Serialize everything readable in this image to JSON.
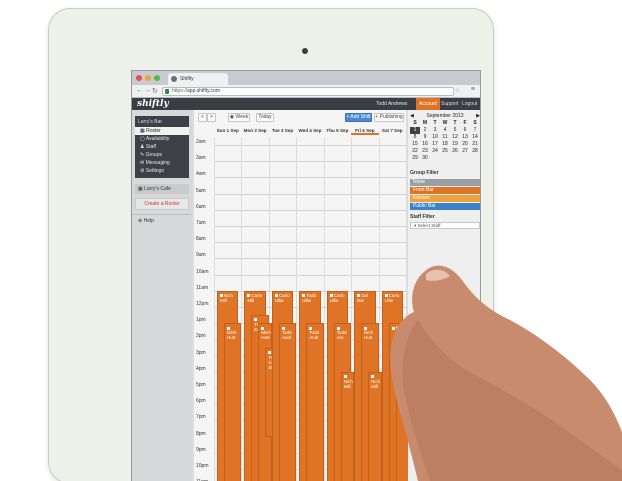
{
  "browser": {
    "tab_title": "Shiftly",
    "url_scheme": "https://",
    "url_host": "app.shiftly.com",
    "traffic_light_colors": [
      "#e2534a",
      "#e5a93a",
      "#56b74b"
    ]
  },
  "app": {
    "logo": "shiftly",
    "user_name": "Todd Andrews",
    "nav": [
      {
        "label": "Account",
        "active": true
      },
      {
        "label": "Support",
        "active": false
      },
      {
        "label": "Logout",
        "active": false
      }
    ],
    "brand_color": "#e07426"
  },
  "sidebar": {
    "venue": "Larry's Bar",
    "items": [
      {
        "label": "Roster",
        "selected": true
      },
      {
        "label": "Availability",
        "selected": false
      },
      {
        "label": "Staff",
        "selected": false
      },
      {
        "label": "Groups",
        "selected": false
      },
      {
        "label": "Messaging",
        "selected": false
      },
      {
        "label": "Settings",
        "selected": false
      }
    ],
    "cafe_link": "Larry's Cafe",
    "create_roster": "Create a Roster",
    "help": "Help"
  },
  "calendar": {
    "controls": {
      "prev": "<",
      "next": ">",
      "view": "Week",
      "today": "Today",
      "add_shift": "+ Add Shift",
      "publish": "+ Publishing"
    },
    "days": [
      {
        "label": "Sun 1 Sep",
        "today": false
      },
      {
        "label": "Mon 2 Sep",
        "today": false
      },
      {
        "label": "Tue 3 Sep",
        "today": false
      },
      {
        "label": "Wed 4 Sep",
        "today": false
      },
      {
        "label": "Thu 5 Sep",
        "today": false
      },
      {
        "label": "Fri 6 Sep",
        "today": true
      },
      {
        "label": "Sat 7 Sep",
        "today": false
      }
    ],
    "times": [
      "2am",
      "3am",
      "4am",
      "5am",
      "6am",
      "7am",
      "8am",
      "9am",
      "10am",
      "11am",
      "12pm",
      "1pm",
      "2pm",
      "3pm",
      "4pm",
      "5pm",
      "6pm",
      "7pm",
      "8pm",
      "9pm",
      "10pm",
      "11pm"
    ],
    "shifts": [
      {
        "day": 0,
        "start": 11.0,
        "end": 23.5,
        "text": "Nich Mill"
      },
      {
        "day": 0,
        "start": 13.0,
        "end": 23.5,
        "text": "Mich Hutt"
      },
      {
        "day": 1,
        "start": 11.0,
        "end": 23.5,
        "text": "Carlo Mill"
      },
      {
        "day": 1,
        "start": 12.5,
        "end": 23.5,
        "text": "Trent Deg"
      },
      {
        "day": 1,
        "start": 13.0,
        "end": 23.5,
        "text": "Mich Hutt"
      },
      {
        "day": 1,
        "start": 14.5,
        "end": 20.0,
        "text": "Todd Glas Sil"
      },
      {
        "day": 2,
        "start": 11.0,
        "end": 23.5,
        "text": "Carlo Ullie"
      },
      {
        "day": 2,
        "start": 13.0,
        "end": 23.5,
        "text": "Todd Andr"
      },
      {
        "day": 3,
        "start": 11.0,
        "end": 23.5,
        "text": "Todd Ullie"
      },
      {
        "day": 3,
        "start": 13.0,
        "end": 23.5,
        "text": "Todd Andr"
      },
      {
        "day": 4,
        "start": 11.0,
        "end": 23.5,
        "text": "Carlo Ullie"
      },
      {
        "day": 4,
        "start": 13.0,
        "end": 23.5,
        "text": "Todd Am"
      },
      {
        "day": 4,
        "start": 16.0,
        "end": 23.5,
        "text": "Nich Mill"
      },
      {
        "day": 5,
        "start": 11.0,
        "end": 23.5,
        "text": "Dal Bar"
      },
      {
        "day": 5,
        "start": 13.0,
        "end": 23.5,
        "text": "Nich Hutt"
      },
      {
        "day": 5,
        "start": 16.0,
        "end": 23.5,
        "text": "Nich Mill"
      },
      {
        "day": 6,
        "start": 11.0,
        "end": 23.5,
        "text": "Carlo Ullie"
      },
      {
        "day": 6,
        "start": 13.0,
        "end": 23.5,
        "text": "Na"
      },
      {
        "day": 6,
        "start": 16.0,
        "end": 23.5,
        "text": "Nich Hy Mill"
      }
    ]
  },
  "mini_calendar": {
    "month": "September 2013",
    "prev": "◀",
    "next": "▶",
    "weekdays": [
      "S",
      "M",
      "T",
      "W",
      "T",
      "F",
      "S"
    ],
    "dates": [
      "1",
      "2",
      "3",
      "4",
      "5",
      "6",
      "7",
      "8",
      "9",
      "10",
      "11",
      "12",
      "13",
      "14",
      "15",
      "16",
      "17",
      "18",
      "19",
      "20",
      "21",
      "22",
      "23",
      "24",
      "25",
      "26",
      "27",
      "28",
      "29",
      "30"
    ],
    "selected": "1"
  },
  "filters": {
    "group_title": "Group Filter",
    "groups": [
      {
        "label": "None",
        "color": "#9b9ea3"
      },
      {
        "label": "Front Bar",
        "color": "#e07426"
      },
      {
        "label": "Kitchen",
        "color": "#f0a23a"
      },
      {
        "label": "Public Bar",
        "color": "#3b82c9"
      }
    ],
    "staff_title": "Staff Filter",
    "staff_select": "Select Staff"
  }
}
